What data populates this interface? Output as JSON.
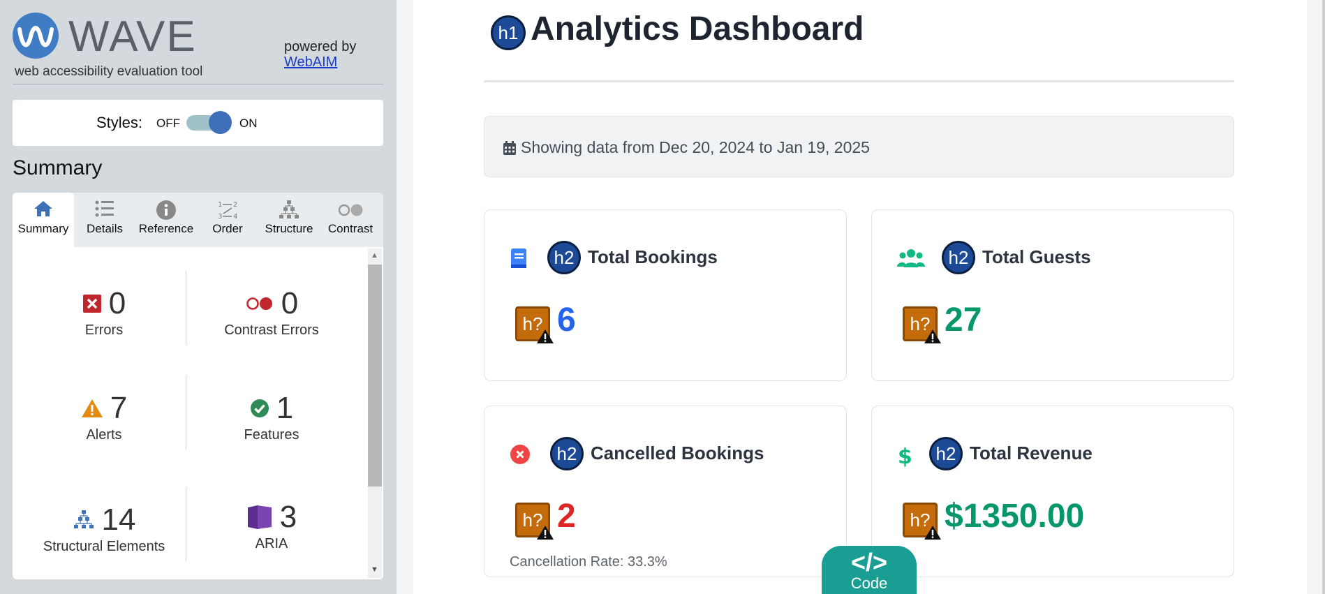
{
  "sidebar": {
    "logo_word": "WAVE",
    "tagline": "web accessibility evaluation tool",
    "powered_by": "powered by",
    "webaim_link": "WebAIM",
    "styles_label": "Styles:",
    "styles_off": "OFF",
    "styles_on": "ON",
    "styles_enabled": true,
    "summary_heading": "Summary",
    "tabs": [
      {
        "label": "Summary",
        "icon": "home-icon",
        "active": true
      },
      {
        "label": "Details",
        "icon": "list-icon",
        "active": false
      },
      {
        "label": "Reference",
        "icon": "info-icon",
        "active": false
      },
      {
        "label": "Order",
        "icon": "order-icon",
        "active": false
      },
      {
        "label": "Structure",
        "icon": "structure-icon",
        "active": false
      },
      {
        "label": "Contrast",
        "icon": "contrast-icon",
        "active": false
      }
    ],
    "stats": {
      "errors": {
        "count": "0",
        "label": "Errors"
      },
      "contrast_errors": {
        "count": "0",
        "label": "Contrast Errors"
      },
      "alerts": {
        "count": "7",
        "label": "Alerts"
      },
      "features": {
        "count": "1",
        "label": "Features"
      },
      "structural": {
        "count": "14",
        "label": "Structural Elements"
      },
      "aria": {
        "count": "3",
        "label": "ARIA"
      }
    }
  },
  "main": {
    "h1_badge": "h1",
    "title": "Analytics Dashboard",
    "date_range": "Showing data from Dec 20, 2024 to Jan 19, 2025",
    "cards": [
      {
        "h2": "h2",
        "title": "Total Bookings",
        "badge": "h?",
        "value": "6",
        "value_color": "#2563eb",
        "icon": "book-icon"
      },
      {
        "h2": "h2",
        "title": "Total Guests",
        "badge": "h?",
        "value": "27",
        "value_color": "#059669",
        "icon": "users-icon"
      },
      {
        "h2": "h2",
        "title": "Cancelled Bookings",
        "badge": "h?",
        "value": "2",
        "value_color": "#dc2626",
        "icon": "cancel-circle-icon",
        "note": "Cancellation Rate: 33.3%"
      },
      {
        "h2": "h2",
        "title": "Total Revenue",
        "badge": "h?",
        "value": "$1350.00",
        "value_color": "#059669",
        "icon": "dollar-icon"
      }
    ],
    "code_symbol": "</>",
    "code_label": "Code"
  },
  "colors": {
    "wave_blue": "#3f7cc4",
    "heading_badge": "#1c4a96",
    "alert_badge": "#c46c0c",
    "code_tab": "#1a9d92"
  }
}
